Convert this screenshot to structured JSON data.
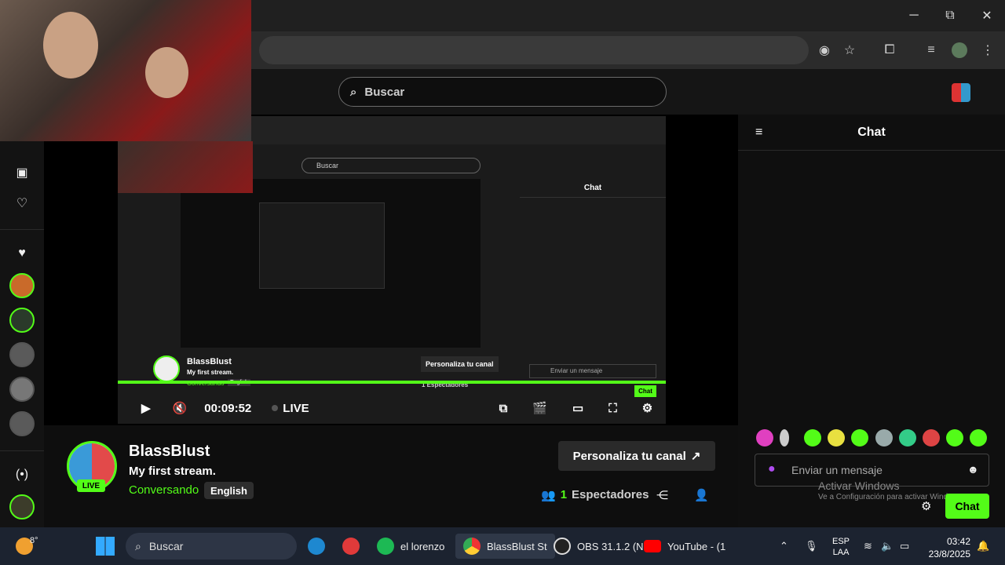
{
  "browser": {
    "window_controls": {
      "minimize": "─",
      "maximize": "⧉",
      "close": "✕"
    }
  },
  "header": {
    "search_placeholder": "Buscar"
  },
  "video": {
    "time": "00:09:52",
    "live_label": "LIVE",
    "inner": {
      "search": "Buscar",
      "chat_title": "Chat",
      "channel": "BlassBlust",
      "stream_title": "My first stream.",
      "category": "Conversando",
      "tag": "English",
      "personaliza": "Personaliza tu canal",
      "viewers": "1 Espectadores",
      "chat_placeholder": "Enviar un mensaje",
      "chat_button": "Chat"
    }
  },
  "chat": {
    "title": "Chat",
    "placeholder": "Enviar un mensaje",
    "send_label": "Chat",
    "watermark_title": "Activar Windows",
    "watermark_sub": "Ve a Configuración para activar Windows."
  },
  "channel": {
    "name": "BlassBlust",
    "stream_title": "My first stream.",
    "category": "Conversando",
    "tag": "English",
    "live_badge": "LIVE",
    "personaliza_label": "Personaliza tu canal",
    "viewer_count": "1",
    "viewers_label": "Espectadores"
  },
  "taskbar": {
    "weather": "8°",
    "search": "Buscar",
    "apps": [
      {
        "label": "el lorenzo"
      },
      {
        "label": "BlassBlust St"
      },
      {
        "label": "OBS 31.1.2 (N"
      },
      {
        "label": "YouTube - (1"
      }
    ],
    "lang_top": "ESP",
    "lang_bottom": "LAA",
    "time": "03:42",
    "date": "23/8/2025"
  },
  "colors": {
    "accent": "#53fc18"
  }
}
